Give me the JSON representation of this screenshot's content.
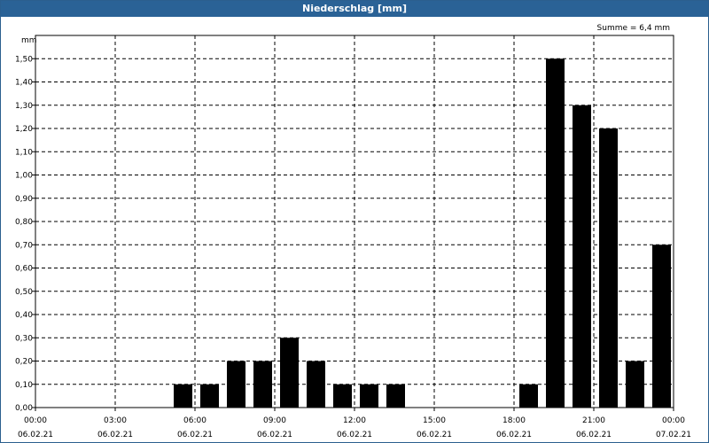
{
  "window": {
    "title": "Niederschlag [mm]"
  },
  "chart_data": {
    "type": "bar",
    "title": "Niederschlag [mm]",
    "ylabel": "mm",
    "annotation": "Summe = 6,4 mm",
    "ylim": [
      0,
      1.6
    ],
    "y_ticks": [
      "0,00",
      "0,10",
      "0,20",
      "0,30",
      "0,40",
      "0,50",
      "0,60",
      "0,70",
      "0,80",
      "0,90",
      "1,00",
      "1,10",
      "1,20",
      "1,30",
      "1,40",
      "1,50"
    ],
    "x_range_hours": [
      0,
      24
    ],
    "x_ticks": [
      {
        "hour": 0,
        "time": "00:00",
        "date": "06.02.21"
      },
      {
        "hour": 3,
        "time": "03:00",
        "date": "06.02.21"
      },
      {
        "hour": 6,
        "time": "06:00",
        "date": "06.02.21"
      },
      {
        "hour": 9,
        "time": "09:00",
        "date": "06.02.21"
      },
      {
        "hour": 12,
        "time": "12:00",
        "date": "06.02.21"
      },
      {
        "hour": 15,
        "time": "15:00",
        "date": "06.02.21"
      },
      {
        "hour": 18,
        "time": "18:00",
        "date": "06.02.21"
      },
      {
        "hour": 21,
        "time": "21:00",
        "date": "06.02.21"
      },
      {
        "hour": 24,
        "time": "00:00",
        "date": "07.02.21"
      }
    ],
    "bars": [
      {
        "hour": 6,
        "value": 0.1
      },
      {
        "hour": 7,
        "value": 0.1
      },
      {
        "hour": 8,
        "value": 0.2
      },
      {
        "hour": 9,
        "value": 0.2
      },
      {
        "hour": 10,
        "value": 0.3
      },
      {
        "hour": 11,
        "value": 0.2
      },
      {
        "hour": 12,
        "value": 0.1
      },
      {
        "hour": 13,
        "value": 0.1
      },
      {
        "hour": 14,
        "value": 0.1
      },
      {
        "hour": 19,
        "value": 0.1
      },
      {
        "hour": 20,
        "value": 1.5
      },
      {
        "hour": 21,
        "value": 1.3
      },
      {
        "hour": 22,
        "value": 1.2
      },
      {
        "hour": 23,
        "value": 0.2
      },
      {
        "hour": 24,
        "value": 0.7
      }
    ],
    "bar_color": "#000000",
    "grid": true,
    "grid_style": "dashed"
  }
}
